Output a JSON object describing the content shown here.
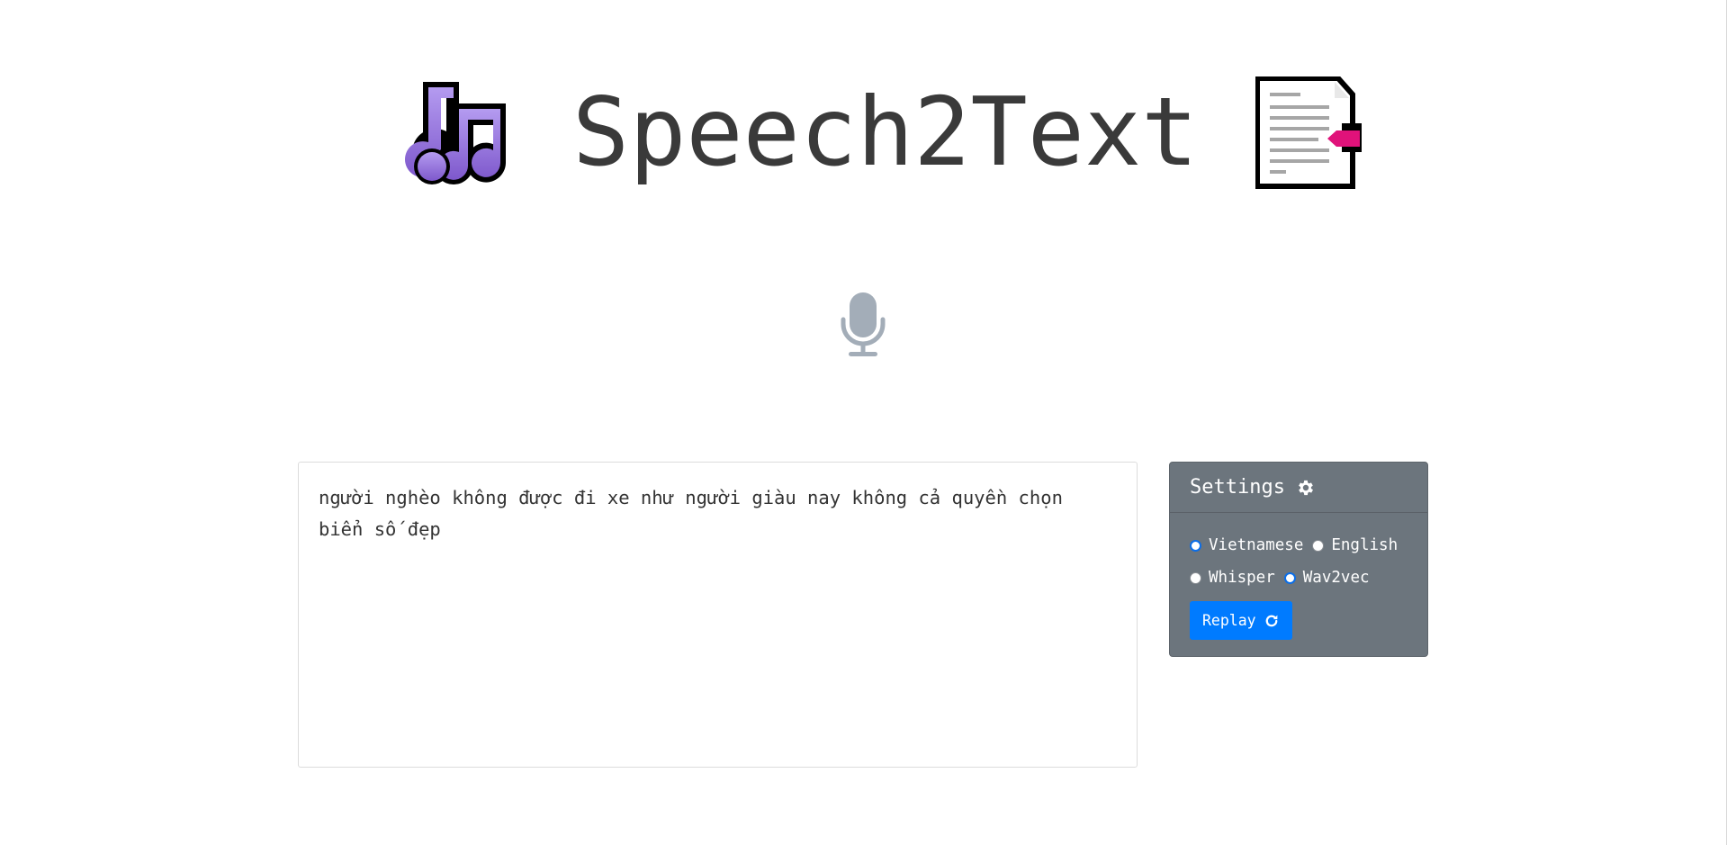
{
  "header": {
    "title": "Speech2Text",
    "left_icon": "music-notes-icon",
    "right_icon": "document-icon"
  },
  "mic": {
    "icon": "microphone-icon",
    "color": "#a3adb8"
  },
  "transcript": {
    "value": "người nghèo không được đi xe như người giàu nay không cả quyền chọn biển số đẹp"
  },
  "settings": {
    "title": "Settings",
    "title_icon": "gear-icon",
    "language": {
      "options": [
        "Vietnamese",
        "English"
      ],
      "selected": "Vietnamese"
    },
    "model": {
      "options": [
        "Whisper",
        "Wav2vec"
      ],
      "selected": "Wav2vec"
    },
    "replay_label": "Replay",
    "replay_icon": "refresh-icon"
  },
  "colors": {
    "settings_bg": "#6c757d",
    "button_bg": "#007bff",
    "title_text": "#3a3a3a",
    "music_icon_purple": "#8c6ad6",
    "document_tag_pink": "#e0127a"
  }
}
